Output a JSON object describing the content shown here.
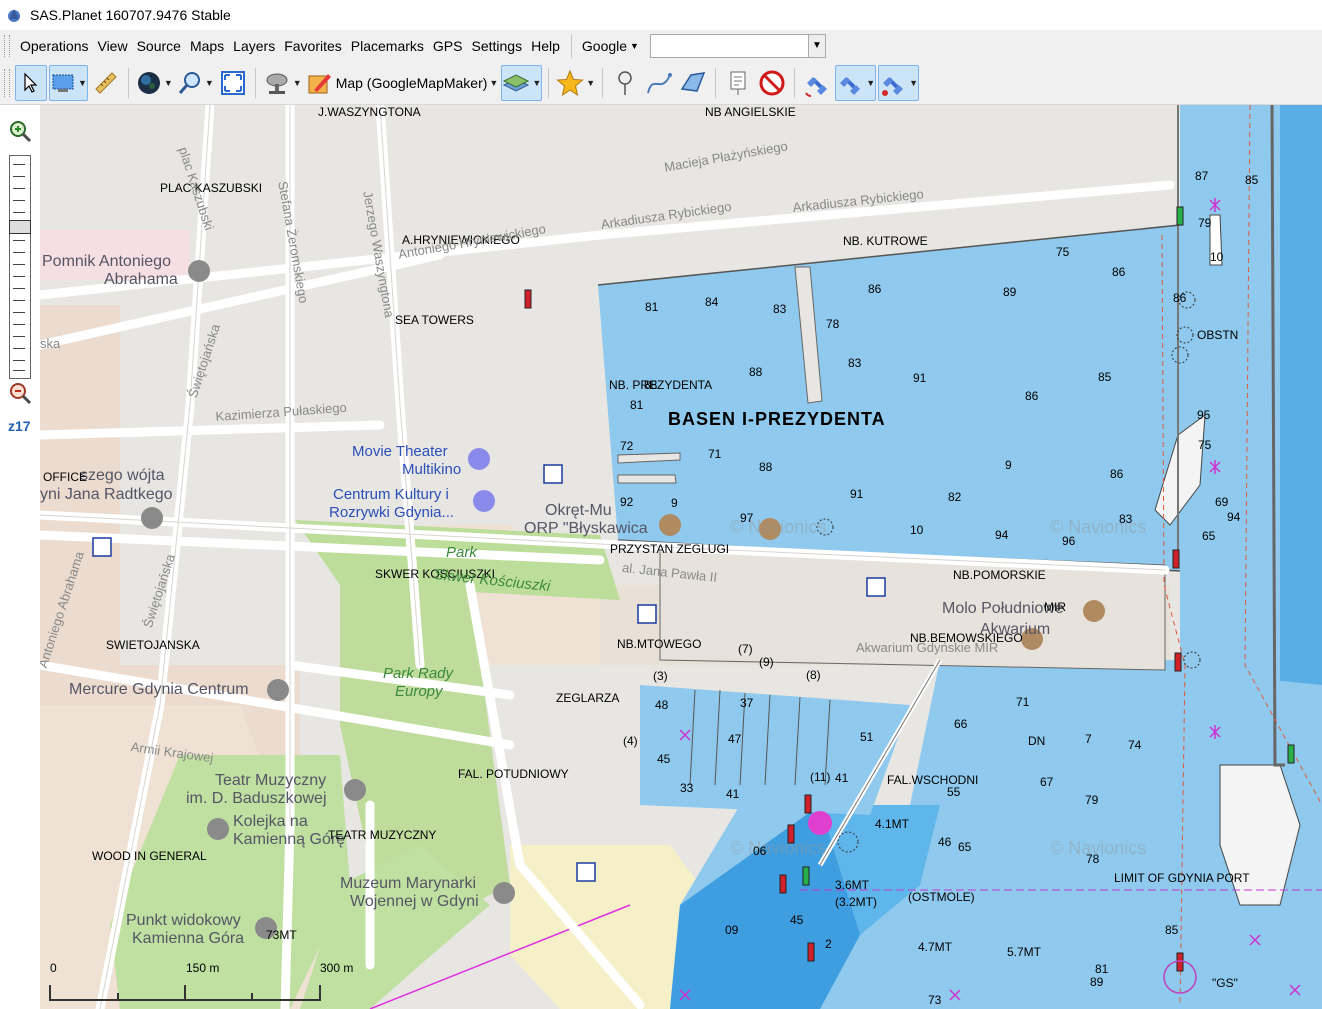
{
  "window": {
    "title": "SAS.Planet 160707.9476 Stable"
  },
  "menu": {
    "items": [
      "Operations",
      "View",
      "Source",
      "Maps",
      "Layers",
      "Favorites",
      "Placemarks",
      "GPS",
      "Settings",
      "Help"
    ],
    "search_engine": "Google",
    "search_value": ""
  },
  "toolbar": {
    "map_source_label": "Map (GoogleMapMaker)"
  },
  "zoom": {
    "level_label": "z17",
    "level": 17
  },
  "map": {
    "title_label": "BASEN I-PREZYDENTA",
    "labels": [
      {
        "t": "J.WASZYNGTONA",
        "c": "lbl"
      },
      {
        "t": "NB ANGIELSKIE",
        "c": "lbl"
      },
      {
        "t": "PLAC KASZUBSKI",
        "c": "lbl"
      },
      {
        "t": "plac Kaszubski",
        "c": "lbl road"
      },
      {
        "t": "Stefana Żeromskiego",
        "c": "lbl road"
      },
      {
        "t": "Jerzego Waszyngtona",
        "c": "lbl road"
      },
      {
        "t": "Macieja Płażyńskiego",
        "c": "lbl road"
      },
      {
        "t": "Arkadiusza Rybickiego",
        "c": "lbl road"
      },
      {
        "t": "Arkadiusza Rybickiego",
        "c": "lbl road"
      },
      {
        "t": "A.HRYNIEWICKIEGO",
        "c": "lbl"
      },
      {
        "t": "Antoniego Hryniewickiego",
        "c": "lbl road"
      },
      {
        "t": "NB. KUTROWE",
        "c": "lbl"
      },
      {
        "t": "Pomnik Antoniego",
        "c": "lbl big"
      },
      {
        "t": "Abrahama",
        "c": "lbl big"
      },
      {
        "t": "SEA TOWERS",
        "c": "lbl"
      },
      {
        "t": "ska",
        "c": "lbl road"
      },
      {
        "t": "NB. PREZYDENTA",
        "c": "lbl"
      },
      {
        "t": "OBSTN",
        "c": "lbl"
      },
      {
        "t": "Kazimierza Pułaskiego",
        "c": "lbl road"
      },
      {
        "t": "Świętojańska",
        "c": "lbl road"
      },
      {
        "t": "Movie Theater",
        "c": "lbl blue"
      },
      {
        "t": "Multikino",
        "c": "lbl blue"
      },
      {
        "t": "OFFICE",
        "c": "lbl"
      },
      {
        "t": "szego wójta",
        "c": "lbl big"
      },
      {
        "t": "yni Jana Radtkego",
        "c": "lbl big"
      },
      {
        "t": "Centrum Kultury i",
        "c": "lbl blue"
      },
      {
        "t": "Rozrywki Gdynia...",
        "c": "lbl blue"
      },
      {
        "t": "Okręt-Mu",
        "c": "lbl big"
      },
      {
        "t": "ORP \"Błyskawica",
        "c": "lbl big"
      },
      {
        "t": "Park",
        "c": "lbl park"
      },
      {
        "t": "PRZYSTAN ZEGLUGI",
        "c": "lbl"
      },
      {
        "t": "al. Jana Pawła II",
        "c": "lbl road"
      },
      {
        "t": "SKWER KOSCIUSZKI",
        "c": "lbl"
      },
      {
        "t": "Skwer Kościuszki",
        "c": "lbl park"
      },
      {
        "t": "Antoniego Abrahama",
        "c": "lbl road"
      },
      {
        "t": "Świętojańska",
        "c": "lbl road"
      },
      {
        "t": "NB.POMORSKIE",
        "c": "lbl"
      },
      {
        "t": "Molo Południowe",
        "c": "lbl big"
      },
      {
        "t": "MIR",
        "c": "lbl"
      },
      {
        "t": "SWIETOJANSKA",
        "c": "lbl"
      },
      {
        "t": "NB.MTOWEGO",
        "c": "lbl"
      },
      {
        "t": "NB.BEMOWSKIEGO",
        "c": "lbl"
      },
      {
        "t": "Akwarium",
        "c": "lbl big"
      },
      {
        "t": "Akwarium Gdyńskie MIR",
        "c": "lbl road"
      },
      {
        "t": "Park Rady",
        "c": "lbl park"
      },
      {
        "t": "Europy",
        "c": "lbl park"
      },
      {
        "t": "Mercure Gdynia Centrum",
        "c": "lbl big"
      },
      {
        "t": "ZEGLARZA",
        "c": "lbl"
      },
      {
        "t": "Armii Krajowej",
        "c": "lbl road"
      },
      {
        "t": "DN",
        "c": "lbl"
      },
      {
        "t": "FAL. POTUDNIOWY",
        "c": "lbl"
      },
      {
        "t": "Teatr Muzyczny",
        "c": "lbl big"
      },
      {
        "t": "im. D. Baduszkowej",
        "c": "lbl big"
      },
      {
        "t": "FAL.WSCHODNI",
        "c": "lbl"
      },
      {
        "t": "Kolejka na",
        "c": "lbl big"
      },
      {
        "t": "Kamienną Górę",
        "c": "lbl big"
      },
      {
        "t": "TEATR MUZYCZNY",
        "c": "lbl"
      },
      {
        "t": "4.1MT",
        "c": "lbl"
      },
      {
        "t": "WOOD IN GENERAL",
        "c": "lbl"
      },
      {
        "t": "Muzeum Marynarki",
        "c": "lbl big"
      },
      {
        "t": "Wojennej w Gdyni",
        "c": "lbl big"
      },
      {
        "t": "3.6MT",
        "c": "lbl"
      },
      {
        "t": "(3.2MT)",
        "c": "lbl"
      },
      {
        "t": "(OSTMOLE)",
        "c": "lbl"
      },
      {
        "t": "LIMIT OF GDYNIA PORT",
        "c": "lbl"
      },
      {
        "t": "Punkt widokowy",
        "c": "lbl big"
      },
      {
        "t": "Kamienna Góra",
        "c": "lbl big"
      },
      {
        "t": "73MT",
        "c": "lbl"
      },
      {
        "t": "4.7MT",
        "c": "lbl"
      },
      {
        "t": "5.7MT",
        "c": "lbl"
      },
      {
        "t": "\"GS\"",
        "c": "lbl"
      },
      {
        "t": "© Navionics",
        "c": "lbl wm"
      },
      {
        "t": "© Navionics",
        "c": "lbl wm"
      },
      {
        "t": "© Navionics",
        "c": "lbl wm"
      },
      {
        "t": "© Navionics",
        "c": "lbl wm"
      }
    ],
    "depths": [
      "81",
      "84",
      "83",
      "86",
      "78",
      "89",
      "75",
      "86",
      "86",
      "87",
      "79",
      "10",
      "85",
      "88",
      "83",
      "91",
      "85",
      "86",
      "88",
      "81",
      "72",
      "71",
      "88",
      "9",
      "86",
      "91",
      "82",
      "83",
      "94",
      "95",
      "75",
      "65",
      "69",
      "92",
      "9",
      "97",
      "10",
      "94",
      "96",
      "48",
      "37",
      "45",
      "47",
      "(4)",
      "(3)",
      "(7)",
      "(9)",
      "(8)",
      "(11)",
      "41",
      "33",
      "41",
      "51",
      "66",
      "71",
      "7",
      "74",
      "67",
      "55",
      "79",
      "46",
      "65",
      "78",
      "06",
      "09",
      "45",
      "2",
      "85",
      "81",
      "73",
      "89"
    ],
    "scale": {
      "labels": [
        "0",
        "150 m",
        "300 m"
      ]
    }
  }
}
